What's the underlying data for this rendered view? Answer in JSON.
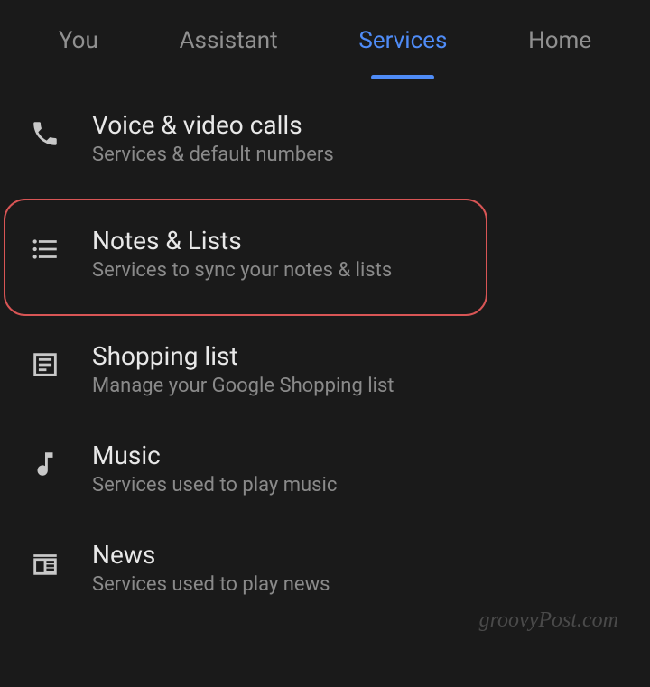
{
  "tabs": [
    {
      "label": "You",
      "active": false
    },
    {
      "label": "Assistant",
      "active": false
    },
    {
      "label": "Services",
      "active": true
    },
    {
      "label": "Home",
      "active": false
    }
  ],
  "settings": [
    {
      "icon": "phone",
      "title": "Voice & video calls",
      "subtitle": "Services & default numbers",
      "highlighted": false
    },
    {
      "icon": "list",
      "title": "Notes & Lists",
      "subtitle": "Services to sync your notes & lists",
      "highlighted": true
    },
    {
      "icon": "shopping",
      "title": "Shopping list",
      "subtitle": "Manage your Google Shopping list",
      "highlighted": false
    },
    {
      "icon": "music",
      "title": "Music",
      "subtitle": "Services used to play music",
      "highlighted": false
    },
    {
      "icon": "news",
      "title": "News",
      "subtitle": "Services used to play news",
      "highlighted": false
    }
  ],
  "watermark": "groovyPost.com"
}
